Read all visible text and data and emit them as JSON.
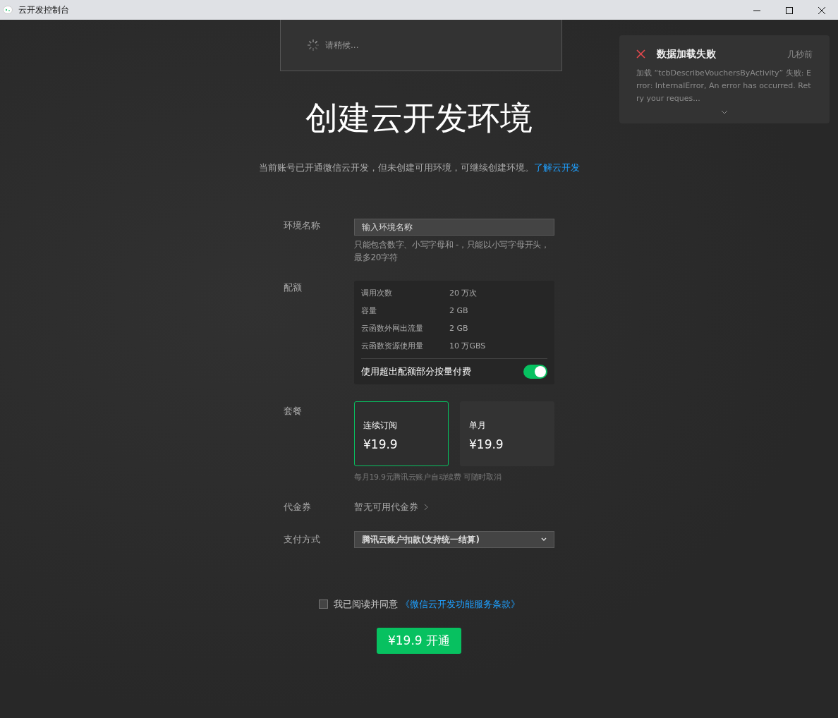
{
  "window": {
    "title": "云开发控制台"
  },
  "loading": {
    "text": "请稍候..."
  },
  "toast": {
    "title": "数据加载失败",
    "time": "几秒前",
    "message": "加载 “tcbDescribeVouchersByActivity” 失败: Error: InternalError, An error has occurred. Retry your reques...",
    "expanded": false
  },
  "heading": "创建云开发环境",
  "intro": {
    "text": "当前账号已开通微信云开发，但未创建可用环境，可继续创建环境。",
    "link": "了解云开发"
  },
  "form": {
    "env_name": {
      "label": "环境名称",
      "placeholder": "输入环境名称",
      "hint": "只能包含数字、小写字母和 -，只能以小写字母开头，最多20字符"
    },
    "quota": {
      "label": "配额",
      "rows": [
        {
          "name": "调用次数",
          "value": "20 万次"
        },
        {
          "name": "容量",
          "value": "2 GB"
        },
        {
          "name": "云函数外网出流量",
          "value": "2 GB"
        },
        {
          "name": "云函数资源使用量",
          "value": "10 万GBS"
        }
      ],
      "overage": {
        "label": "使用超出配额部分按量付费",
        "on": true
      }
    },
    "plan": {
      "label": "套餐",
      "options": [
        {
          "name": "连续订阅",
          "price": "¥19.9",
          "selected": true
        },
        {
          "name": "单月",
          "price": "¥19.9",
          "selected": false
        }
      ],
      "note": "每月19.9元腾讯云账户自动续费 可随时取消"
    },
    "voucher": {
      "label": "代金券",
      "value": "暂无可用代金券"
    },
    "payment": {
      "label": "支付方式",
      "value": "腾讯云账户扣款(支持统一结算)"
    }
  },
  "agreement": {
    "text": "我已阅读并同意",
    "link": "《微信云开发功能服务条款》",
    "checked": false
  },
  "submit": "¥19.9 开通"
}
